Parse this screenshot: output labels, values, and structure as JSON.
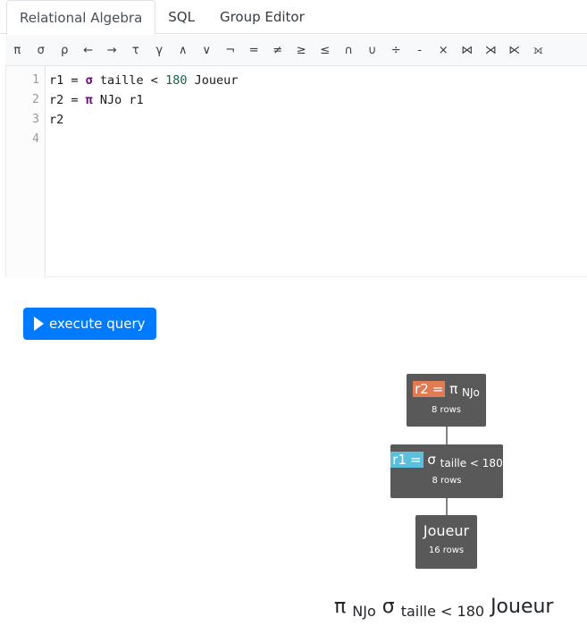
{
  "tabs": [
    {
      "label": "Relational Algebra",
      "active": true
    },
    {
      "label": "SQL",
      "active": false
    },
    {
      "label": "Group Editor",
      "active": false
    }
  ],
  "operators": [
    "π",
    "σ",
    "ρ",
    "←",
    "→",
    "τ",
    "γ",
    "∧",
    "∨",
    "¬",
    "=",
    "≠",
    "≥",
    "≤",
    "∩",
    "∪",
    "÷",
    "-",
    "×",
    "⋈",
    "⋊",
    "⋉",
    "⟗"
  ],
  "editor": {
    "line_numbers": [
      "1",
      "2",
      "3",
      "4"
    ],
    "lines": [
      {
        "a": "r1 = ",
        "op": "σ",
        "b": " taille < ",
        "num": "180",
        "c": " Joueur"
      },
      {
        "a": "r2 = ",
        "op": "π",
        "b": " NJo r1",
        "num": "",
        "c": ""
      },
      {
        "a": "r2",
        "op": "",
        "b": "",
        "num": "",
        "c": ""
      },
      {
        "a": "",
        "op": "",
        "b": "",
        "num": "",
        "c": ""
      }
    ]
  },
  "execute_button": {
    "label": "execute query",
    "icon": "play-icon"
  },
  "tree": {
    "nodes": [
      {
        "tag": "r2",
        "tag_color": "#e07b53",
        "eq": "=",
        "op": "π",
        "sub": "NJo",
        "rows": "8 rows"
      },
      {
        "tag": "r1",
        "tag_color": "#5bc0de",
        "eq": "=",
        "op": "σ",
        "sub": "taille < 180",
        "rows": "8 rows"
      },
      {
        "tag": "",
        "tag_color": "",
        "eq": "",
        "op": "Joueur",
        "sub": "",
        "rows": "16 rows"
      }
    ]
  },
  "expression": {
    "op1": "π",
    "sub1": "NJo",
    "op2": "σ",
    "sub2": "taille < 180",
    "rel": "Joueur"
  },
  "colors": {
    "accent": "#007bff",
    "node_bg": "#595959"
  }
}
